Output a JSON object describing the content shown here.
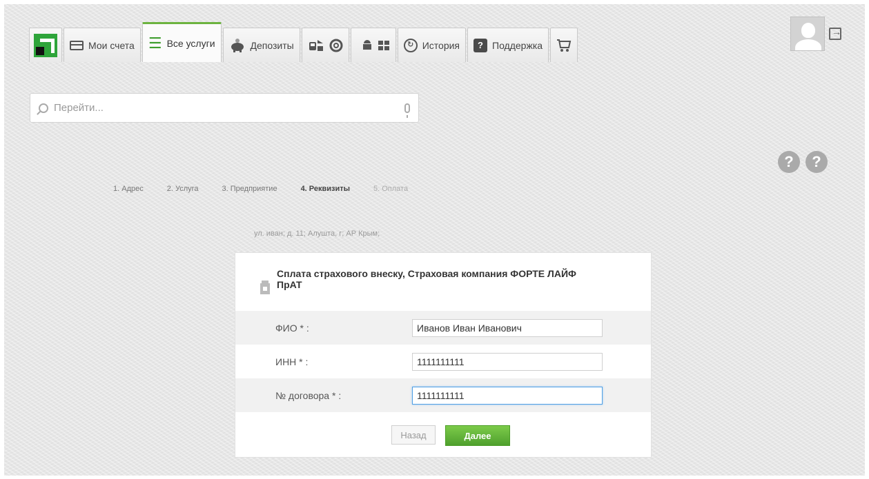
{
  "nav": {
    "tabs": [
      {
        "label": "Мои счета",
        "icon": "card-icon"
      },
      {
        "label": "Все услуги",
        "icon": "list-icon",
        "active": true
      },
      {
        "label": "Депозиты",
        "icon": "piggy-bank-icon"
      },
      {
        "label": "История",
        "icon": "history-icon"
      },
      {
        "label": "Поддержка",
        "icon": "help-icon"
      }
    ]
  },
  "search": {
    "placeholder": "Перейти..."
  },
  "steps": [
    {
      "label": "1.  Адрес"
    },
    {
      "label": "2.  Услуга"
    },
    {
      "label": "3.  Предприятие"
    },
    {
      "label": "4.  Реквизиты",
      "state": "current"
    },
    {
      "label": "5.  Оплата",
      "state": "future"
    }
  ],
  "address": "ул. иван; д. 11; Алушта, г; АР Крым;",
  "form": {
    "title": "Сплата страхового внеску, Страховая компания ФОРТЕ ЛАЙФ ПрАТ",
    "fields": [
      {
        "label": "ФИО * :",
        "value": "Иванов Иван Иванович"
      },
      {
        "label": "ИНН * :",
        "value": "1111111111"
      },
      {
        "label": "№ договора * :",
        "value": "1111111111"
      }
    ],
    "back_label": "Назад",
    "next_label": "Далее"
  },
  "colors": {
    "accent": "#6cb33f",
    "next_button": "#5cae33",
    "focus_border": "#4f9fe5"
  }
}
